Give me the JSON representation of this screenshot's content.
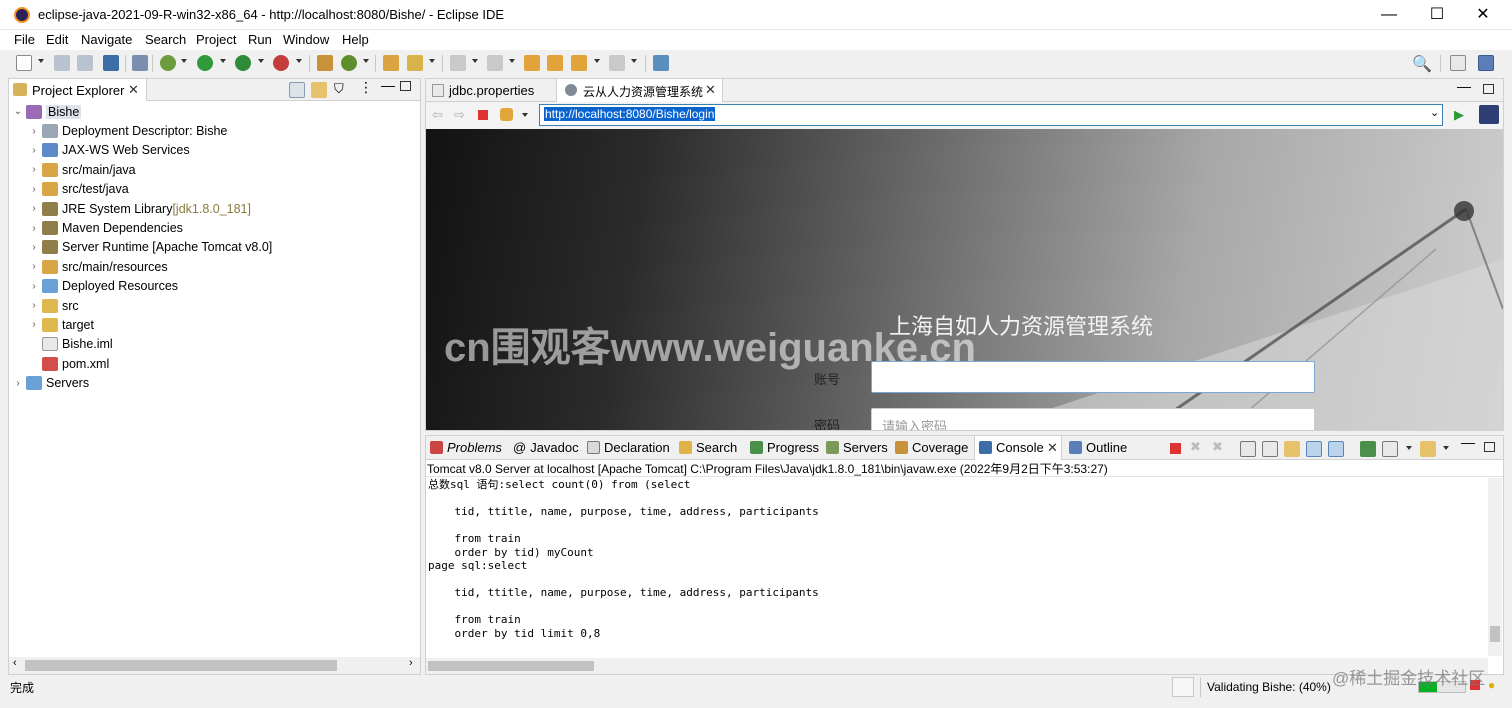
{
  "window": {
    "title": "eclipse-java-2021-09-R-win32-x86_64 - http://localhost:8080/Bishe/ - Eclipse IDE",
    "minimize": "—",
    "maximize": "☐",
    "close": "✕"
  },
  "menu": [
    "File",
    "Edit",
    "Navigate",
    "Search",
    "Project",
    "Run",
    "Window",
    "Help"
  ],
  "project_explorer": {
    "tab": "Project Explorer",
    "root": "Bishe",
    "items": [
      {
        "label": "Deployment Descriptor: Bishe",
        "suffix": ""
      },
      {
        "label": "JAX-WS Web Services",
        "suffix": ""
      },
      {
        "label": "src/main/java",
        "suffix": ""
      },
      {
        "label": "src/test/java",
        "suffix": ""
      },
      {
        "label": "JRE System Library ",
        "suffix": "[jdk1.8.0_181]"
      },
      {
        "label": "Maven Dependencies",
        "suffix": ""
      },
      {
        "label": "Server Runtime [Apache Tomcat v8.0]",
        "suffix": ""
      },
      {
        "label": "src/main/resources",
        "suffix": ""
      },
      {
        "label": "Deployed Resources",
        "suffix": ""
      },
      {
        "label": "src",
        "suffix": ""
      },
      {
        "label": "target",
        "suffix": ""
      },
      {
        "label": "Bishe.iml",
        "suffix": ""
      },
      {
        "label": "pom.xml",
        "suffix": ""
      }
    ],
    "servers": "Servers"
  },
  "editor": {
    "tabs": [
      "jdbc.properties",
      "云从人力资源管理系统"
    ],
    "url": "http://localhost:8080/Bishe/login",
    "page": {
      "heading": "上海自如人力资源管理系统",
      "account_label": "账号",
      "password_label": "密码",
      "password_placeholder": "请输入密码",
      "watermark": "cn围观客www.weiguanke.cn"
    }
  },
  "console": {
    "tabs": [
      "Problems",
      "Javadoc",
      "Declaration",
      "Search",
      "Progress",
      "Servers",
      "Coverage",
      "Console",
      "Outline"
    ],
    "header": "Tomcat v8.0 Server at localhost [Apache Tomcat] C:\\Program Files\\Java\\jdk1.8.0_181\\bin\\javaw.exe  (2022年9月2日下午3:53:27)",
    "lines": [
      "总数sql 语句:select count(0) from (select",
      "",
      "    tid, ttitle, name, purpose, time, address, participants",
      "",
      "    from train",
      "    order by tid) myCount",
      "page sql:select",
      "",
      "    tid, ttitle, name, purpose, time, address, participants",
      "",
      "    from train",
      "    order by tid limit 0,8"
    ]
  },
  "status": {
    "left": "完成",
    "validation": "Validating Bishe: (40%)",
    "progress": 0.4,
    "watermark": "@稀土掘金技术社区"
  }
}
